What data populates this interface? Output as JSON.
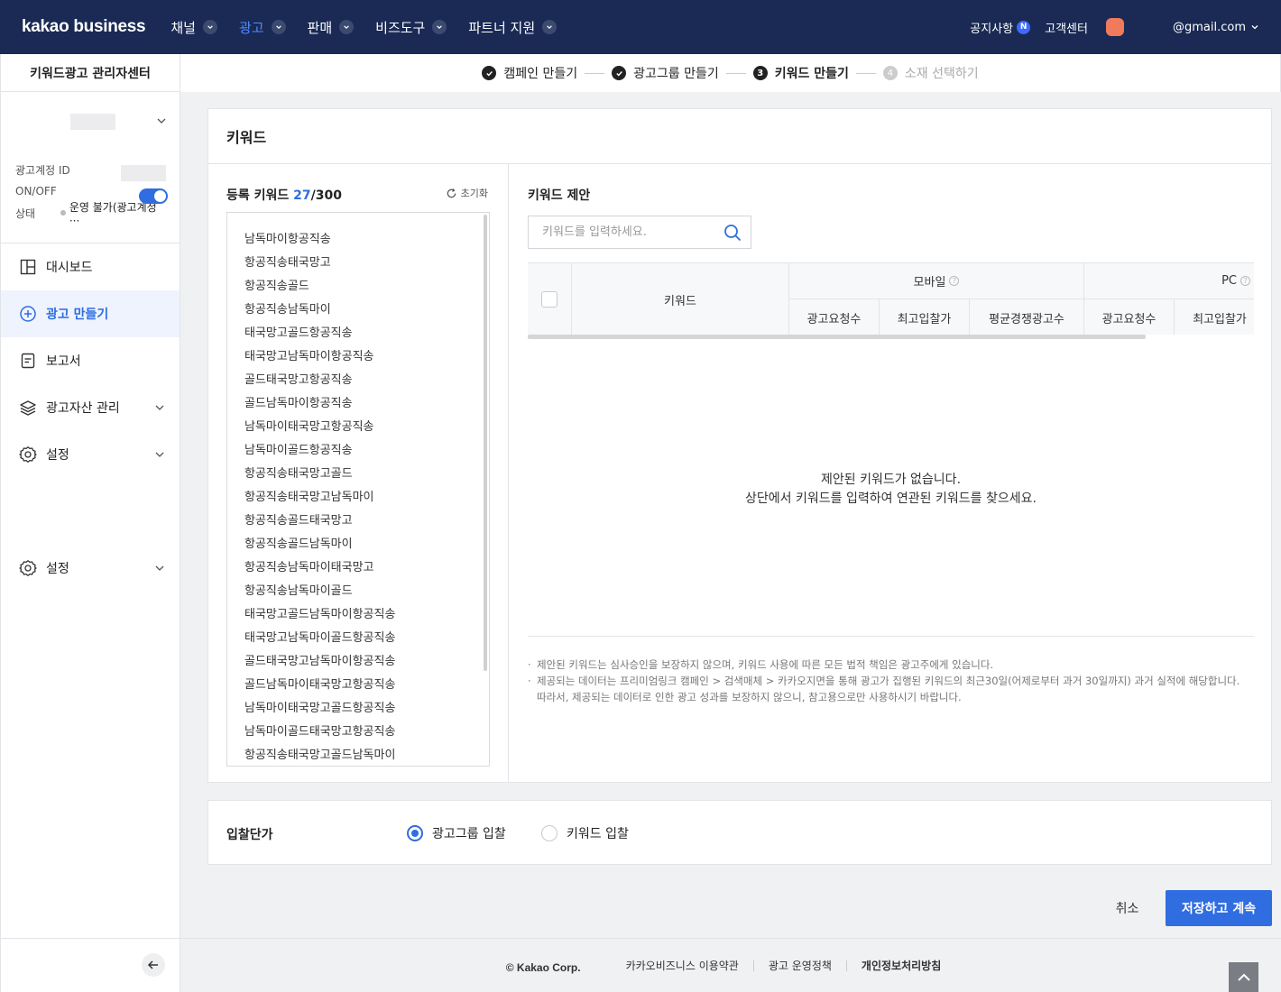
{
  "topnav": {
    "logo": "kakao business",
    "menu": [
      {
        "label": "채널"
      },
      {
        "label": "광고"
      },
      {
        "label": "판매"
      },
      {
        "label": "비즈도구"
      },
      {
        "label": "파트너 지원"
      }
    ],
    "notice": "공지사항",
    "notice_badge": "N",
    "support": "고객센터",
    "email": "@gmail.com"
  },
  "sidebar": {
    "title": "키워드광고 관리자센터",
    "account_id_label": "광고계정 ID",
    "onoff_label": "ON/OFF",
    "status_label": "상태",
    "status_value": "운영 불가(광고계정 ···",
    "nav": [
      {
        "label": "대시보드",
        "icon": "dashboard-icon"
      },
      {
        "label": "광고 만들기",
        "icon": "plus-circle-icon"
      },
      {
        "label": "보고서",
        "icon": "report-icon"
      },
      {
        "label": "광고자산 관리",
        "icon": "layers-icon"
      },
      {
        "label": "설정",
        "icon": "gear-icon"
      },
      {
        "label": "설정",
        "icon": "gear-icon"
      }
    ]
  },
  "steps": [
    {
      "num": "",
      "label": "캠페인 만들기"
    },
    {
      "num": "",
      "label": "광고그룹 만들기"
    },
    {
      "num": "3",
      "label": "키워드 만들기"
    },
    {
      "num": "4",
      "label": "소재 선택하기"
    }
  ],
  "keyword_panel": {
    "title": "키워드",
    "registered_label": "등록 키워드",
    "registered_count": "27",
    "registered_max": "/300",
    "reset_label": "초기화",
    "keywords": [
      "남독마이항공직송",
      "항공직송태국망고",
      "항공직송골드",
      "항공직송남독마이",
      "태국망고골드항공직송",
      "태국망고남독마이항공직송",
      "골드태국망고항공직송",
      "골드남독마이항공직송",
      "남독마이태국망고항공직송",
      "남독마이골드항공직송",
      "항공직송태국망고골드",
      "항공직송태국망고남독마이",
      "항공직송골드태국망고",
      "항공직송골드남독마이",
      "항공직송남독마이태국망고",
      "항공직송남독마이골드",
      "태국망고골드남독마이항공직송",
      "태국망고남독마이골드항공직송",
      "골드태국망고남독마이항공직송",
      "골드남독마이태국망고항공직송",
      "남독마이태국망고골드항공직송",
      "남독마이골드태국망고항공직송",
      "항공직송태국망고골드남독마이"
    ],
    "suggest_title": "키워드 제안",
    "search_placeholder": "키워드를 입력하세요.",
    "table": {
      "keyword_col": "키워드",
      "mobile_group": "모바일",
      "pc_group": "PC",
      "mobile_cols": [
        "광고요청수",
        "최고입찰가",
        "평균경쟁광고수"
      ],
      "pc_cols": [
        "광고요청수",
        "최고입찰가"
      ]
    },
    "empty_line1": "제안된 키워드가 없습니다.",
    "empty_line2": "상단에서 키워드를 입력하여 연관된 키워드를 찾으세요.",
    "notes": [
      "제안된 키워드는 심사승인을 보장하지 않으며, 키워드 사용에 따른 모든 법적 책임은 광고주에게 있습니다.",
      "제공되는 데이터는 프리미엄링크 캠페인 > 검색매체 > 카카오지면을 통해 광고가 집행된 키워드의 최근30일(어제로부터 과거 30일까지) 과거 실적에 해당합니다.",
      "따라서, 제공되는 데이터로 인한 광고 성과를 보장하지 않으니, 참고용으로만 사용하시기 바랍니다."
    ]
  },
  "bid": {
    "label": "입찰단가",
    "option_group": "광고그룹 입찰",
    "option_keyword": "키워드 입찰",
    "selected": "광고그룹 입찰"
  },
  "actions": {
    "cancel": "취소",
    "save": "저장하고 계속"
  },
  "footer": {
    "copyright": "© Kakao Corp.",
    "links": [
      "카카오비즈니스 이용약관",
      "광고 운영정책",
      "개인정보처리방침"
    ]
  },
  "colors": {
    "nav_bg": "#1a2a55",
    "accent": "#2f6de0",
    "avatar": "#f07a5c"
  }
}
